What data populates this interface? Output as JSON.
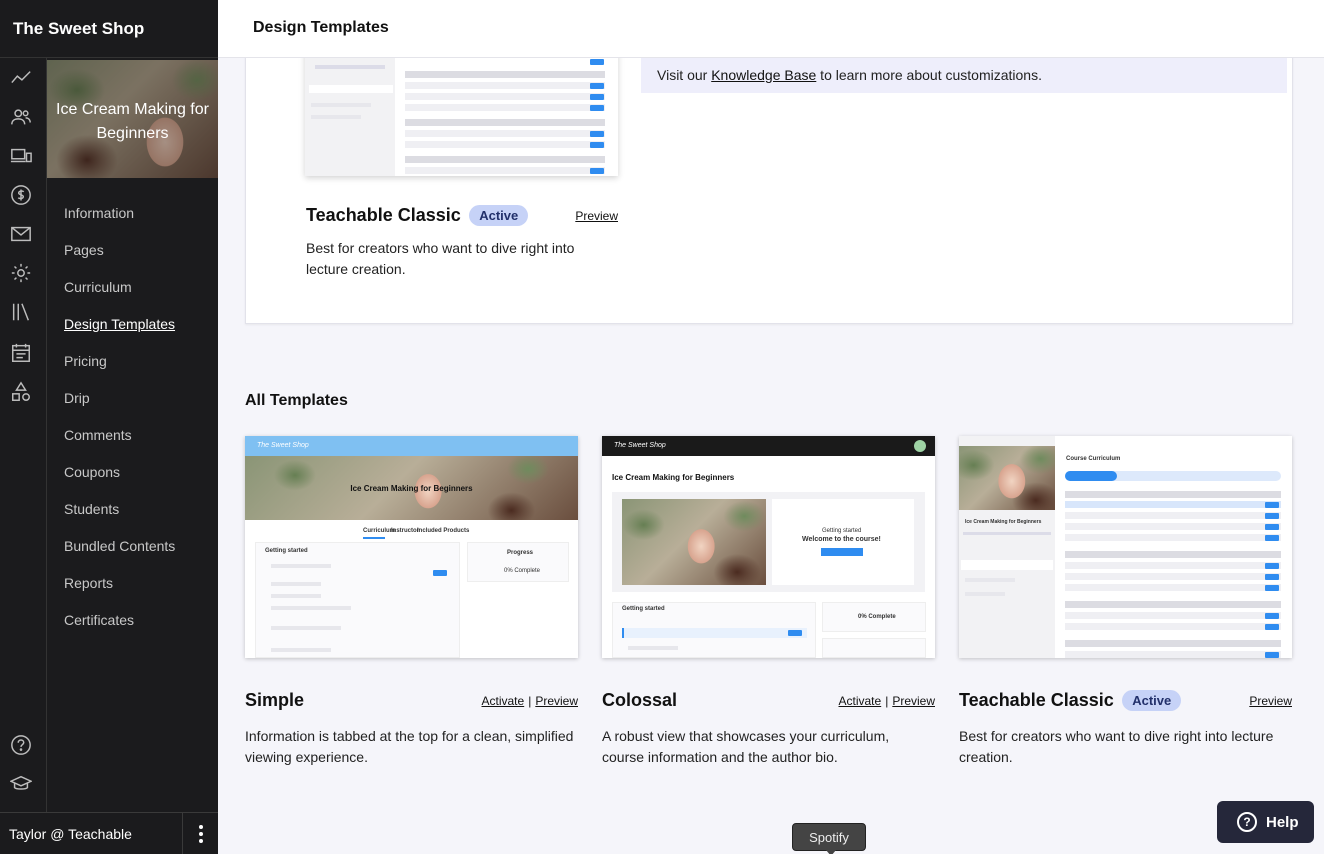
{
  "app": {
    "school_name": "The Sweet Shop",
    "user": "Taylor @ Teachable"
  },
  "rail_icons": [
    "trend-line-icon",
    "users-icon",
    "devices-icon",
    "dollar-icon",
    "mail-icon",
    "gear-icon",
    "library-icon",
    "calendar-icon",
    "shapes-icon",
    "help-circle-icon",
    "graduation-cap-icon"
  ],
  "course": {
    "title": "Ice Cream Making for Beginners"
  },
  "nav": {
    "items": [
      "Information",
      "Pages",
      "Curriculum",
      "Design Templates",
      "Pricing",
      "Drip",
      "Comments",
      "Coupons",
      "Students",
      "Bundled Contents",
      "Reports",
      "Certificates"
    ],
    "active": "Design Templates"
  },
  "page": {
    "title": "Design Templates"
  },
  "current": {
    "info_prefix": "Visit our ",
    "info_link": "Knowledge Base",
    "info_suffix": " to learn more about customizations.",
    "name": "Teachable Classic",
    "badge": "Active",
    "preview": "Preview",
    "description": "Best for creators who want to dive right into lecture creation."
  },
  "all_templates": {
    "heading": "All Templates",
    "cards": [
      {
        "name": "Simple",
        "activate": "Activate",
        "preview": "Preview",
        "description": "Information is tabbed at the top for a clean, simplified viewing experience."
      },
      {
        "name": "Colossal",
        "activate": "Activate",
        "preview": "Preview",
        "description": "A robust view that showcases your curriculum, course information and the author bio."
      },
      {
        "name": "Teachable Classic",
        "badge": "Active",
        "preview": "Preview",
        "description": "Best for creators who want to dive right into lecture creation."
      }
    ]
  },
  "thumb_text": {
    "brand": "The Sweet Shop",
    "course": "Ice Cream Making for Beginners",
    "tab_curriculum": "Curriculum",
    "tab_instructor": "Instructor",
    "tab_products": "Included Products",
    "progress": "Progress",
    "complete": "0% Complete",
    "getting_started": "Getting started",
    "welcome": "Welcome to the course!",
    "start": "Start course",
    "course_curriculum": "Course Curriculum"
  },
  "help": {
    "label": "Help"
  },
  "tooltip": {
    "label": "Spotify"
  },
  "colors": {
    "sidebar": "#1b1b1d",
    "accent": "#2f8cf0",
    "badge": "#c6d2f7",
    "info_bg": "#eeeefb",
    "help_bg": "#25273a"
  }
}
